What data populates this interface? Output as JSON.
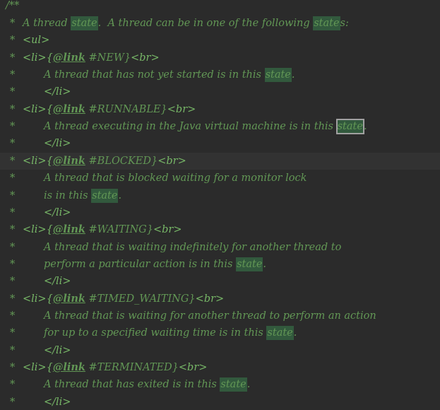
{
  "editor": {
    "comment_open": "/**",
    "star": "*",
    "search_term": "state",
    "lines": [
      {
        "before": "A thread ",
        "match": "state",
        "after": ".  A thread can be in one of the following ",
        "match2": "state",
        "after2": "s:"
      },
      {
        "tag": "<ul>"
      },
      {
        "li_open": "<li>{",
        "annotation": "@link",
        "ref": " #NEW}",
        "br": "<br>"
      },
      {
        "before": "A thread that has not yet started is in this ",
        "match": "state",
        "after": "."
      },
      {
        "li_close": "</li>"
      },
      {
        "li_open": "<li>{",
        "annotation": "@link",
        "ref": " #RUNNABLE}",
        "br": "<br>"
      },
      {
        "before": "A thread executing in the Java virtual machine is in this ",
        "match": "state",
        "after": "."
      },
      {
        "li_close": "</li>"
      },
      {
        "li_open": "<li>{",
        "annotation": "@link",
        "ref": " #BLOCKED}",
        "br": "<br>"
      },
      {
        "text": "A thread that is blocked waiting for a monitor lock"
      },
      {
        "before": "is in this ",
        "match": "state",
        "after": "."
      },
      {
        "li_close": "</li>"
      },
      {
        "li_open": "<li>{",
        "annotation": "@link",
        "ref": " #WAITING}",
        "br": "<br>"
      },
      {
        "text": "A thread that is waiting indefinitely for another thread to"
      },
      {
        "before": "perform a particular action is in this ",
        "match": "state",
        "after": "."
      },
      {
        "li_close": "</li>"
      },
      {
        "li_open": "<li>{",
        "annotation": "@link",
        "ref": " #TIMED_WAITING}",
        "br": "<br>"
      },
      {
        "text": "A thread that is waiting for another thread to perform an action"
      },
      {
        "before": "for up to a specified waiting time is in this ",
        "match": "state",
        "after": "."
      },
      {
        "li_close": "</li>"
      },
      {
        "li_open": "<li>{",
        "annotation": "@link",
        "ref": " #TERMINATED}",
        "br": "<br>"
      },
      {
        "before": "A thread that has exited is in this ",
        "match": "state",
        "after": "."
      },
      {
        "li_close": "</li>"
      }
    ]
  },
  "colors": {
    "background": "#2b2b2b",
    "doc_comment": "#629755",
    "tag": "#77b767",
    "match_highlight": "#32593d",
    "current_match_border": "#a0a0a0",
    "caret_row": "#323232"
  }
}
